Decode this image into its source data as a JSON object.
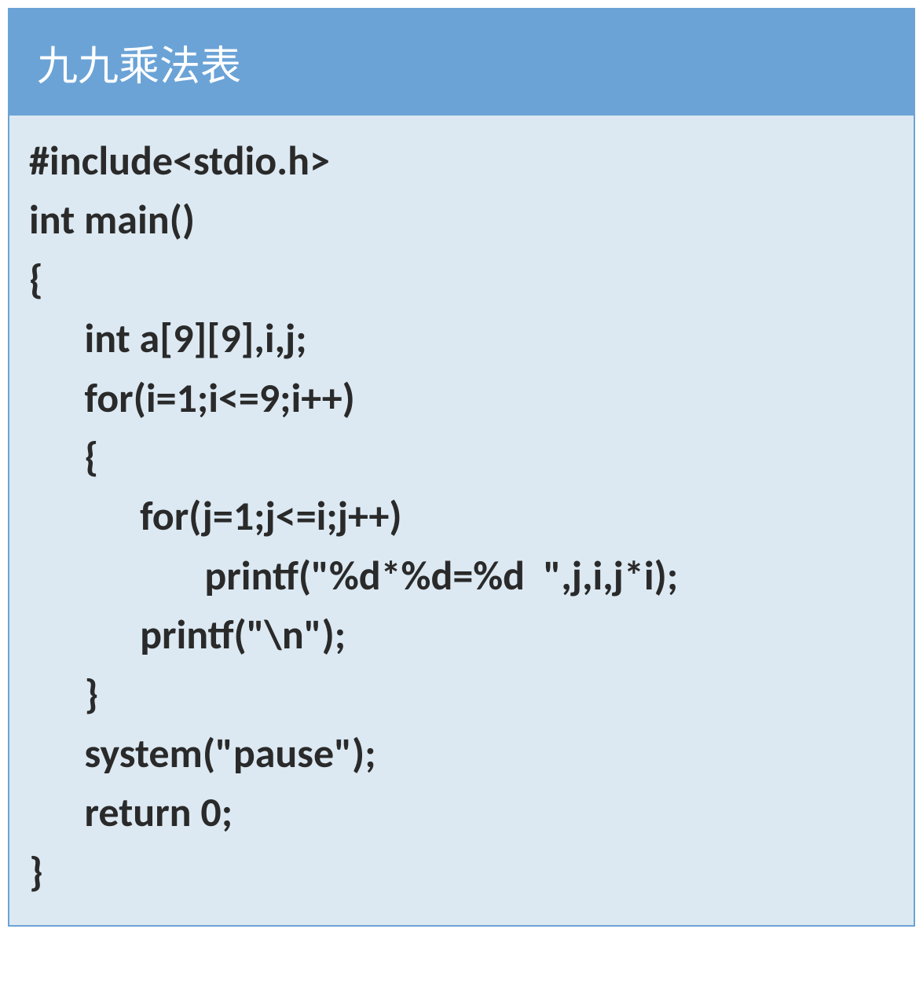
{
  "title": "九九乘法表",
  "code": {
    "line1": "#include<stdio.h>",
    "line2": "int main()",
    "line3": "{",
    "line4": "      int a[9][9],i,j;",
    "line5": "      for(i=1;i<=9;i++)",
    "line6": "      {",
    "line7": "            for(j=1;j<=i;j++)",
    "line8": "                   printf(\"%d*%d=%d  \",j,i,j*i);",
    "line9": "            printf(\"\\n\");",
    "line10": "      }",
    "line11": "      system(\"pause\");",
    "line12": "      return 0;",
    "line13": "}"
  }
}
